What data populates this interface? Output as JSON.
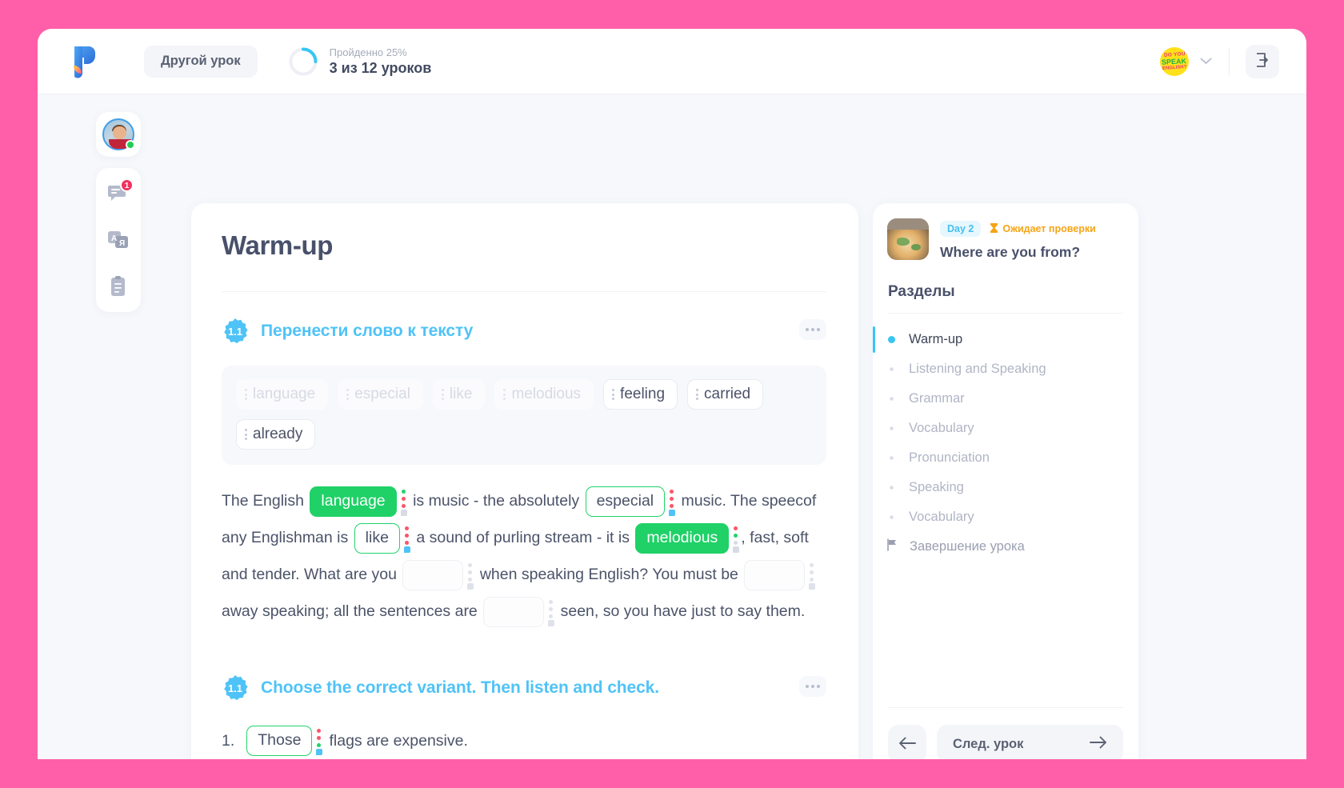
{
  "brand": {
    "accent_blue": "#4fc3f7",
    "green": "#1fd167",
    "red": "#fb5569",
    "page_bg": "#ff5fa8"
  },
  "header": {
    "logo_icon": "speakprint-logo-icon",
    "other_lesson_label": "Другой урок",
    "progress_caption": "Пройденно 25%",
    "progress_value": "3 из 12 уроков",
    "progress_percent": 25,
    "avatar": {
      "line1": "DO YOU",
      "line2": "SPEAK",
      "line3": "ENGLISH?"
    },
    "chevron_icon": "chevron-down-icon",
    "exit_icon": "exit-icon"
  },
  "rail": {
    "avatar_name": "user-avatar",
    "items": [
      {
        "icon": "chat-bubble-icon",
        "badge": "1"
      },
      {
        "icon": "translate-icon",
        "badge": ""
      },
      {
        "icon": "clipboard-icon",
        "badge": ""
      }
    ]
  },
  "lesson": {
    "title": "Warm-up",
    "tasks": [
      {
        "number": "1.1",
        "title": "Перенести слово к тексту",
        "menu_icon": "more-options-icon",
        "word_bank": [
          {
            "word": "language",
            "used": true
          },
          {
            "word": "especial",
            "used": true
          },
          {
            "word": "like",
            "used": true
          },
          {
            "word": "melodious",
            "used": true
          },
          {
            "word": "feeling",
            "used": false
          },
          {
            "word": "carried",
            "used": false
          },
          {
            "word": "already",
            "used": false
          }
        ],
        "paragraph": [
          {
            "t": "text",
            "v": "The English "
          },
          {
            "t": "slot",
            "state": "filled",
            "v": "language",
            "marker": "g"
          },
          {
            "t": "text",
            "v": " is music - the absolutely "
          },
          {
            "t": "slot",
            "state": "outline",
            "v": "especial",
            "marker": "r"
          },
          {
            "t": "text",
            "v": " music.  The speec"
          },
          {
            "t": "text",
            "v": "of any Englishman is "
          },
          {
            "t": "slot",
            "state": "outline",
            "v": "like",
            "marker": "r"
          },
          {
            "t": "text",
            "v": " a sound of purling stream - it is "
          },
          {
            "t": "slot",
            "state": "filled",
            "v": "melodious",
            "marker": "rg"
          },
          {
            "t": "text",
            "v": ", fast, "
          },
          {
            "t": "text",
            "v": "soft and tender.  What are you "
          },
          {
            "t": "slot",
            "state": "empty",
            "v": "",
            "marker": "gray"
          },
          {
            "t": "text",
            "v": " when speaking English?  You must be "
          },
          {
            "t": "slot",
            "state": "empty",
            "v": "",
            "marker": "gray"
          },
          {
            "t": "text",
            "v": " away speaking;  all the sentences are "
          },
          {
            "t": "slot",
            "state": "empty",
            "v": "",
            "marker": "gray"
          },
          {
            "t": "text",
            "v": " seen, so you have "
          },
          {
            "t": "text",
            "v": "just to say them."
          }
        ]
      },
      {
        "number": "1.1",
        "title": "Choose the correct variant. Then listen and check.",
        "menu_icon": "more-options-icon",
        "question_number": "1.",
        "question_answer": "Those",
        "question_tail": "flags are expensive."
      }
    ]
  },
  "sidepanel": {
    "thumb_icon": "globe-photo-thumbnail",
    "day_badge": "Day 2",
    "status_icon": "hourglass-icon",
    "status_label": "Ожидает проверки",
    "lesson_title": "Where are you from?",
    "sections_heading": "Разделы",
    "sections": [
      {
        "label": "Warm-up",
        "active": true,
        "flag": false
      },
      {
        "label": "Listening and Speaking",
        "active": false,
        "flag": false
      },
      {
        "label": "Grammar",
        "active": false,
        "flag": false
      },
      {
        "label": "Vocabulary",
        "active": false,
        "flag": false
      },
      {
        "label": "Pronunciation",
        "active": false,
        "flag": false
      },
      {
        "label": "Speaking",
        "active": false,
        "flag": false
      },
      {
        "label": "Vocabulary",
        "active": false,
        "flag": false
      },
      {
        "label": "Завершение урока",
        "active": false,
        "flag": true
      }
    ],
    "prev_icon": "arrow-left-icon",
    "next_label": "След. урок",
    "next_icon": "arrow-right-icon"
  }
}
